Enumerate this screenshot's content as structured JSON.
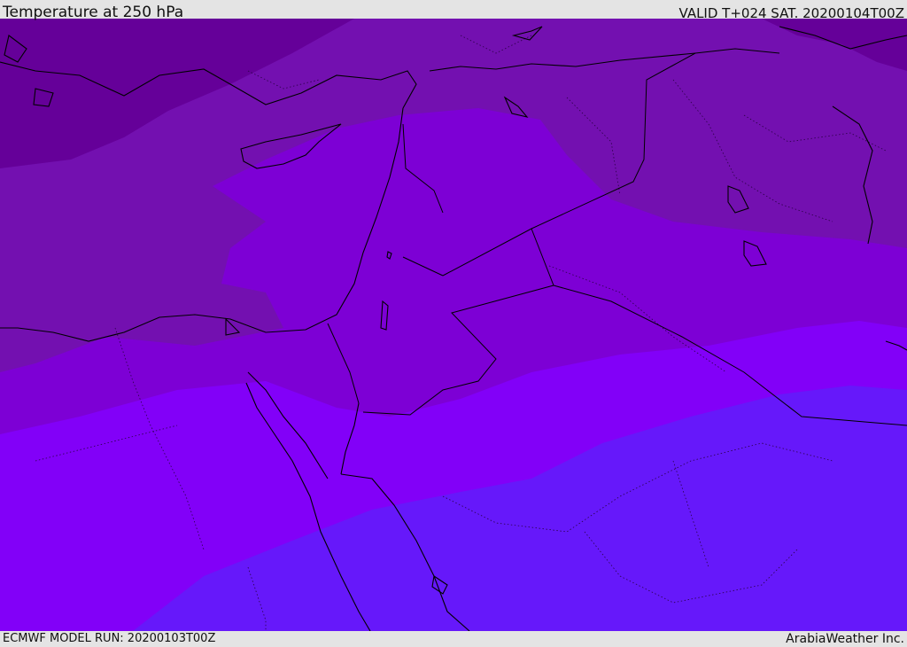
{
  "header": {
    "title": "Temperature at 250 hPa",
    "valid_time": "VALID T+024 SAT. 20200104T00Z"
  },
  "footer": {
    "model_run": "ECMWF MODEL RUN: 20200103T00Z",
    "credit": "ArabiaWeather Inc."
  },
  "map": {
    "variable": "temperature",
    "pressure_level_hpa": 250,
    "colors": {
      "coldest_band": "#650099",
      "cold_band": "#7310b0",
      "mid_band": "#7d00d5",
      "warm_band": "#8200f8",
      "warmest_band": "#6618fa",
      "coastline": "#000000",
      "borders": "#1a0033"
    }
  }
}
